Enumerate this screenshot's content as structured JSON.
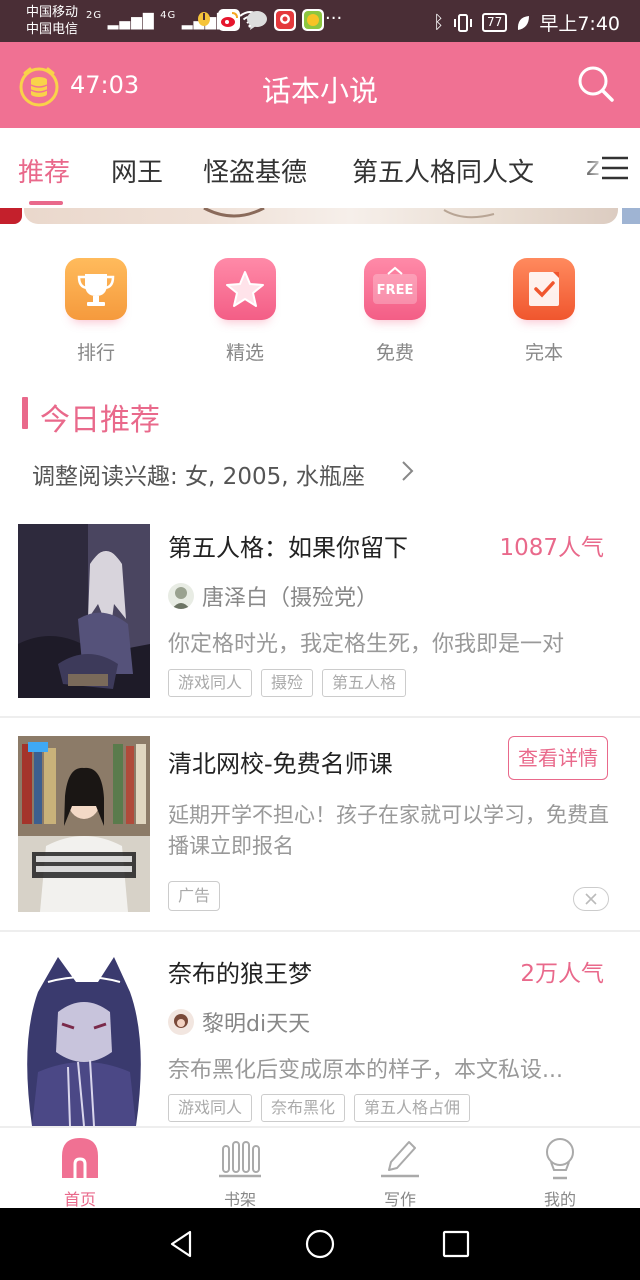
{
  "status_bar": {
    "carrier_1": "中国移动",
    "carrier_2": "中国电信",
    "signal_1": "2G",
    "signal_2": "4G",
    "more": "···",
    "battery": "77",
    "time": "早上7:40",
    "app_icons": [
      "weibo-icon",
      "chat-icon",
      "news-icon",
      "game-icon"
    ]
  },
  "header": {
    "timer": "47:03",
    "title": "话本小说",
    "timer_icon": "coin-stack-clock-icon",
    "search_icon": "search-icon"
  },
  "tabs": {
    "items": [
      "推荐",
      "网王",
      "怪盗基德",
      "第五人格同人文",
      "z"
    ],
    "active_index": 0,
    "menu_icon": "menu-icon"
  },
  "quick_nav": [
    {
      "label": "排行",
      "icon": "trophy-icon",
      "color": "#f7a24a"
    },
    {
      "label": "精选",
      "icon": "star-icon",
      "color": "#f56d91"
    },
    {
      "label": "免费",
      "icon": "free-icon",
      "icon_text": "FREE",
      "color": "#f56d91"
    },
    {
      "label": "完本",
      "icon": "checked-book-icon",
      "color": "#f36a43"
    }
  ],
  "section": {
    "title": "今日推荐",
    "interest": "调整阅读兴趣: 女, 2005, 水瓶座"
  },
  "feed": {
    "book_1": {
      "title": "第五人格：如果你留下",
      "popularity": "1087人气",
      "author": "唐泽白（摄殓党）",
      "description": "你定格时光，我定格生死，你我即是一对",
      "tags": [
        "游戏同人",
        "摄殓",
        "第五人格"
      ]
    },
    "ad": {
      "title": "清北网校-免费名师课",
      "button": "查看详情",
      "description": "延期开学不担心！孩子在家就可以学习，免费直播课立即报名",
      "tag": "广告",
      "close_icon": "close-icon"
    },
    "book_2": {
      "title": "奈布的狼王梦",
      "popularity": "2万人气",
      "author": "黎明di天天",
      "description": "奈布黑化后变成原本的样子，本文私设...",
      "tags": [
        "游戏同人",
        "奈布黑化",
        "第五人格占佣"
      ]
    }
  },
  "bottom_nav": [
    {
      "label": "首页",
      "icon": "home-icon"
    },
    {
      "label": "书架",
      "icon": "bookshelf-icon"
    },
    {
      "label": "写作",
      "icon": "pencil-icon"
    },
    {
      "label": "我的",
      "icon": "profile-icon"
    }
  ],
  "colors": {
    "brand": "#f07193",
    "accent": "#e9698b",
    "status_bar": "#4a2e36"
  }
}
